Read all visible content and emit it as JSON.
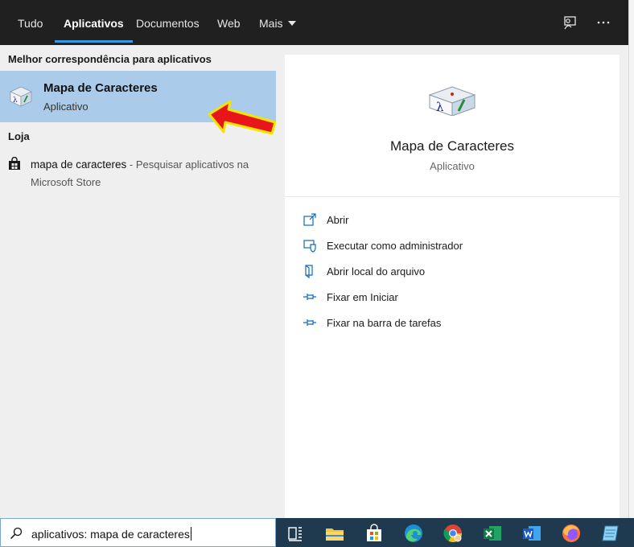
{
  "tabs": [
    {
      "label": "Tudo"
    },
    {
      "label": "Aplicativos"
    },
    {
      "label": "Documentos"
    },
    {
      "label": "Web"
    },
    {
      "label": "Mais"
    }
  ],
  "left": {
    "best_match_heading": "Melhor correspondência para aplicativos",
    "best_match": {
      "title": "Mapa de Caracteres",
      "subtitle": "Aplicativo"
    },
    "store_heading": "Loja",
    "store_item": {
      "title": "mapa de caracteres",
      "suffix": " - Pesquisar aplicativos na Microsoft Store"
    }
  },
  "detail": {
    "title": "Mapa de Caracteres",
    "subtitle": "Aplicativo",
    "actions": [
      {
        "label": "Abrir",
        "icon": "open-icon"
      },
      {
        "label": "Executar como administrador",
        "icon": "shield-icon"
      },
      {
        "label": "Abrir local do arquivo",
        "icon": "file-location-icon"
      },
      {
        "label": "Fixar em Iniciar",
        "icon": "pin-icon"
      },
      {
        "label": "Fixar na barra de tarefas",
        "icon": "pin-icon"
      }
    ]
  },
  "search": {
    "value": "aplicativos: mapa de caracteres"
  },
  "colors": {
    "accent": "#3a96dd",
    "selection": "#aacbe9",
    "tabbar": "#202020",
    "taskbar": "#1f3a4f"
  }
}
